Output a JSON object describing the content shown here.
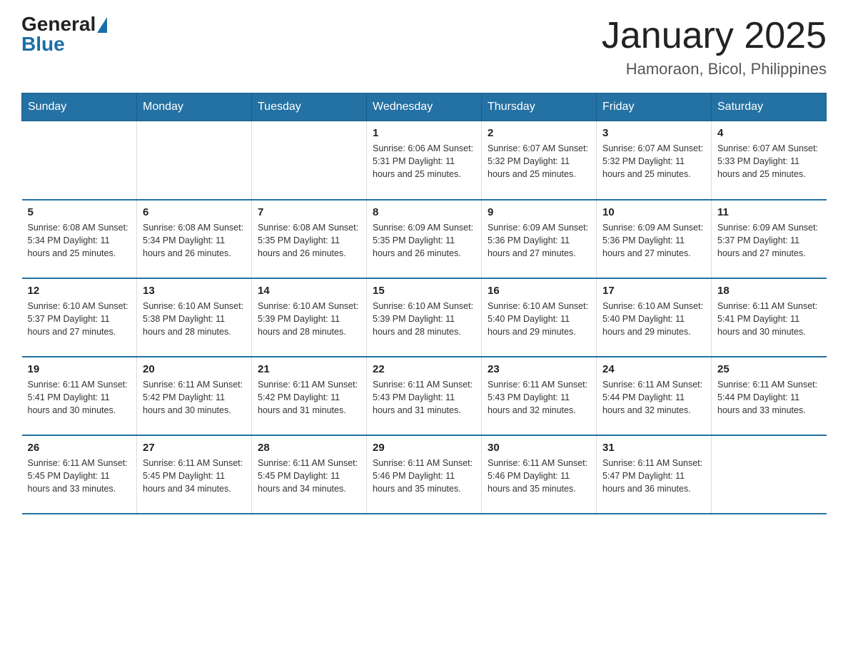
{
  "logo": {
    "text_general": "General",
    "text_blue": "Blue"
  },
  "header": {
    "title": "January 2025",
    "subtitle": "Hamoraon, Bicol, Philippines"
  },
  "weekdays": [
    "Sunday",
    "Monday",
    "Tuesday",
    "Wednesday",
    "Thursday",
    "Friday",
    "Saturday"
  ],
  "weeks": [
    [
      {
        "day": "",
        "info": ""
      },
      {
        "day": "",
        "info": ""
      },
      {
        "day": "",
        "info": ""
      },
      {
        "day": "1",
        "info": "Sunrise: 6:06 AM\nSunset: 5:31 PM\nDaylight: 11 hours and 25 minutes."
      },
      {
        "day": "2",
        "info": "Sunrise: 6:07 AM\nSunset: 5:32 PM\nDaylight: 11 hours and 25 minutes."
      },
      {
        "day": "3",
        "info": "Sunrise: 6:07 AM\nSunset: 5:32 PM\nDaylight: 11 hours and 25 minutes."
      },
      {
        "day": "4",
        "info": "Sunrise: 6:07 AM\nSunset: 5:33 PM\nDaylight: 11 hours and 25 minutes."
      }
    ],
    [
      {
        "day": "5",
        "info": "Sunrise: 6:08 AM\nSunset: 5:34 PM\nDaylight: 11 hours and 25 minutes."
      },
      {
        "day": "6",
        "info": "Sunrise: 6:08 AM\nSunset: 5:34 PM\nDaylight: 11 hours and 26 minutes."
      },
      {
        "day": "7",
        "info": "Sunrise: 6:08 AM\nSunset: 5:35 PM\nDaylight: 11 hours and 26 minutes."
      },
      {
        "day": "8",
        "info": "Sunrise: 6:09 AM\nSunset: 5:35 PM\nDaylight: 11 hours and 26 minutes."
      },
      {
        "day": "9",
        "info": "Sunrise: 6:09 AM\nSunset: 5:36 PM\nDaylight: 11 hours and 27 minutes."
      },
      {
        "day": "10",
        "info": "Sunrise: 6:09 AM\nSunset: 5:36 PM\nDaylight: 11 hours and 27 minutes."
      },
      {
        "day": "11",
        "info": "Sunrise: 6:09 AM\nSunset: 5:37 PM\nDaylight: 11 hours and 27 minutes."
      }
    ],
    [
      {
        "day": "12",
        "info": "Sunrise: 6:10 AM\nSunset: 5:37 PM\nDaylight: 11 hours and 27 minutes."
      },
      {
        "day": "13",
        "info": "Sunrise: 6:10 AM\nSunset: 5:38 PM\nDaylight: 11 hours and 28 minutes."
      },
      {
        "day": "14",
        "info": "Sunrise: 6:10 AM\nSunset: 5:39 PM\nDaylight: 11 hours and 28 minutes."
      },
      {
        "day": "15",
        "info": "Sunrise: 6:10 AM\nSunset: 5:39 PM\nDaylight: 11 hours and 28 minutes."
      },
      {
        "day": "16",
        "info": "Sunrise: 6:10 AM\nSunset: 5:40 PM\nDaylight: 11 hours and 29 minutes."
      },
      {
        "day": "17",
        "info": "Sunrise: 6:10 AM\nSunset: 5:40 PM\nDaylight: 11 hours and 29 minutes."
      },
      {
        "day": "18",
        "info": "Sunrise: 6:11 AM\nSunset: 5:41 PM\nDaylight: 11 hours and 30 minutes."
      }
    ],
    [
      {
        "day": "19",
        "info": "Sunrise: 6:11 AM\nSunset: 5:41 PM\nDaylight: 11 hours and 30 minutes."
      },
      {
        "day": "20",
        "info": "Sunrise: 6:11 AM\nSunset: 5:42 PM\nDaylight: 11 hours and 30 minutes."
      },
      {
        "day": "21",
        "info": "Sunrise: 6:11 AM\nSunset: 5:42 PM\nDaylight: 11 hours and 31 minutes."
      },
      {
        "day": "22",
        "info": "Sunrise: 6:11 AM\nSunset: 5:43 PM\nDaylight: 11 hours and 31 minutes."
      },
      {
        "day": "23",
        "info": "Sunrise: 6:11 AM\nSunset: 5:43 PM\nDaylight: 11 hours and 32 minutes."
      },
      {
        "day": "24",
        "info": "Sunrise: 6:11 AM\nSunset: 5:44 PM\nDaylight: 11 hours and 32 minutes."
      },
      {
        "day": "25",
        "info": "Sunrise: 6:11 AM\nSunset: 5:44 PM\nDaylight: 11 hours and 33 minutes."
      }
    ],
    [
      {
        "day": "26",
        "info": "Sunrise: 6:11 AM\nSunset: 5:45 PM\nDaylight: 11 hours and 33 minutes."
      },
      {
        "day": "27",
        "info": "Sunrise: 6:11 AM\nSunset: 5:45 PM\nDaylight: 11 hours and 34 minutes."
      },
      {
        "day": "28",
        "info": "Sunrise: 6:11 AM\nSunset: 5:45 PM\nDaylight: 11 hours and 34 minutes."
      },
      {
        "day": "29",
        "info": "Sunrise: 6:11 AM\nSunset: 5:46 PM\nDaylight: 11 hours and 35 minutes."
      },
      {
        "day": "30",
        "info": "Sunrise: 6:11 AM\nSunset: 5:46 PM\nDaylight: 11 hours and 35 minutes."
      },
      {
        "day": "31",
        "info": "Sunrise: 6:11 AM\nSunset: 5:47 PM\nDaylight: 11 hours and 36 minutes."
      },
      {
        "day": "",
        "info": ""
      }
    ]
  ]
}
